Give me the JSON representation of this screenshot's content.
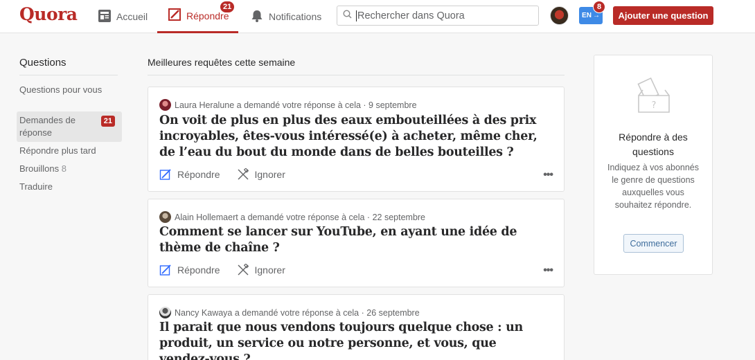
{
  "header": {
    "logo": "Quora",
    "nav": {
      "home_label": "Accueil",
      "answer_label": "Répondre",
      "answer_badge": "21",
      "notifications_label": "Notifications"
    },
    "search_placeholder": "Rechercher dans Quora",
    "lang_label": "EN",
    "lang_badge": "8",
    "add_question_label": "Ajouter une question"
  },
  "sidebar": {
    "title": "Questions",
    "items": [
      {
        "label": "Questions pour vous"
      },
      {
        "label": "Demandes de réponse",
        "badge": "21"
      },
      {
        "label": "Répondre plus tard"
      },
      {
        "label": "Brouillons",
        "count": "8"
      },
      {
        "label": "Traduire"
      }
    ]
  },
  "feed": {
    "title": "Meilleures requêtes cette semaine",
    "answer_label": "Répondre",
    "ignore_label": "Ignorer",
    "more_label": "•••",
    "questions": [
      {
        "asker_line": "Laura Heralune a demandé votre réponse à cela · 9 septembre",
        "text": "On voit de plus en plus des eaux embouteillées à des prix incroyables, êtes-vous intéressé(e) à acheter, même cher, de l’eau du bout du monde dans de belles bouteilles ?"
      },
      {
        "asker_line": "Alain Hollemaert a demandé votre réponse à cela · 22 septembre",
        "text": "Comment se lancer sur YouTube, en ayant une idée de thème de chaîne ?"
      },
      {
        "asker_line": "Nancy Kawaya a demandé votre réponse à cela · 26 septembre",
        "text": "Il parait que nous vendons toujours quelque chose : un produit, un service ou notre personne, et vous, que vendez-vous ?"
      }
    ]
  },
  "right_panel": {
    "title": "Répondre à des questions",
    "description": "Indiquez à vos abonnés le genre de questions auxquelles vous souhaitez répondre.",
    "button_label": "Commencer"
  },
  "colors": {
    "brand": "#b92b27",
    "link_blue": "#2e69ff"
  }
}
